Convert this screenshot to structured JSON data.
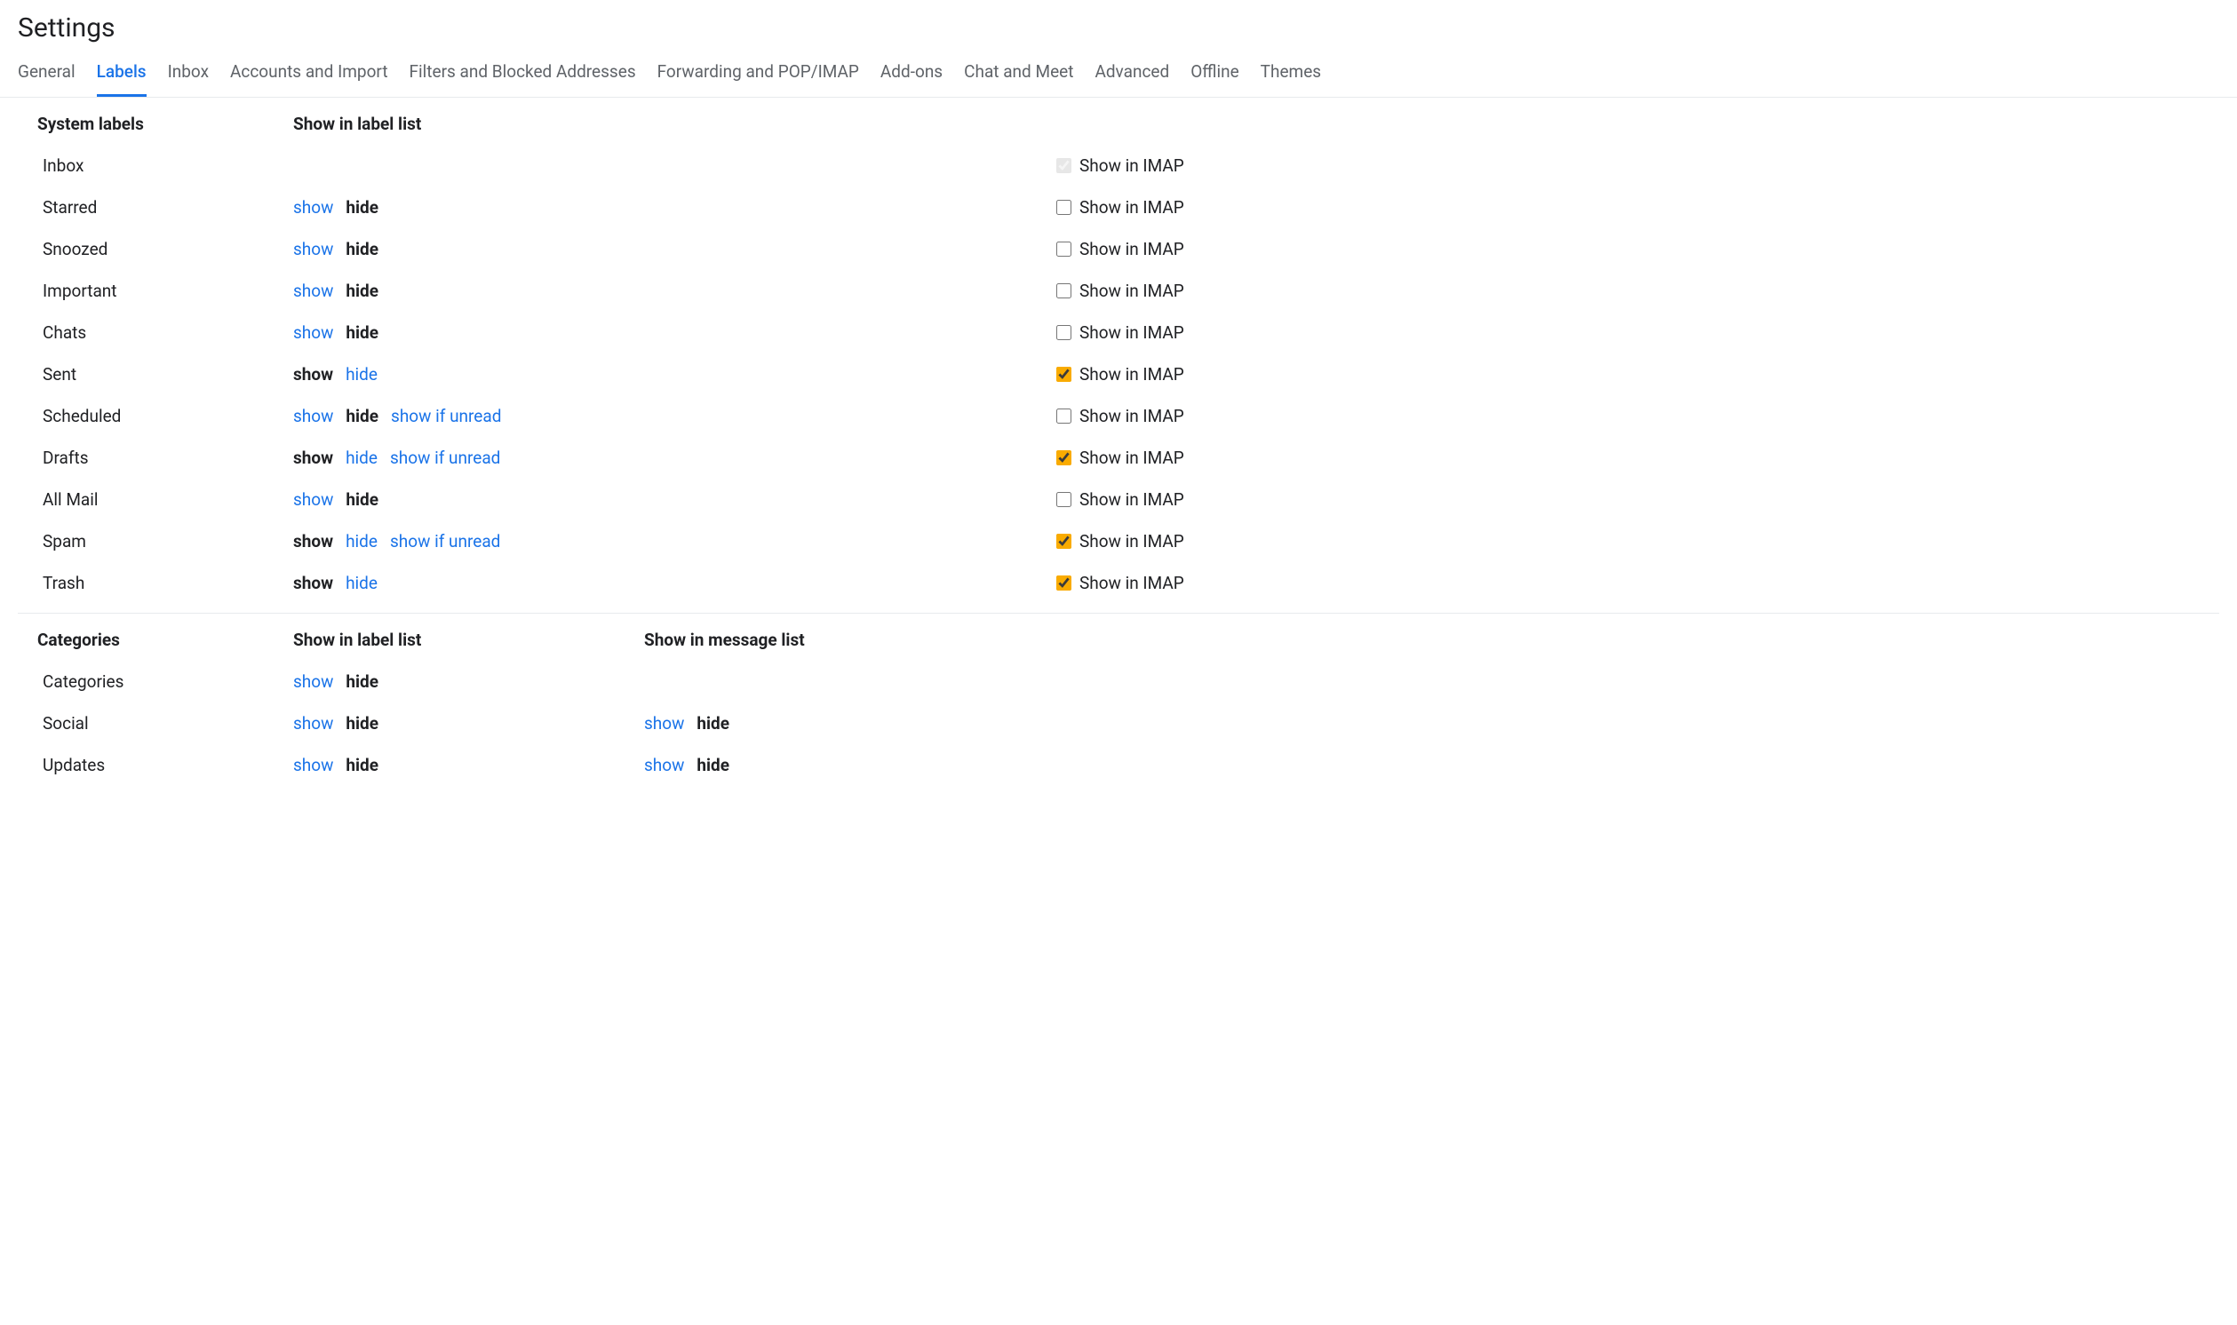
{
  "page_title": "Settings",
  "tabs": [
    {
      "id": "general",
      "label": "General",
      "active": false
    },
    {
      "id": "labels",
      "label": "Labels",
      "active": true
    },
    {
      "id": "inbox",
      "label": "Inbox",
      "active": false
    },
    {
      "id": "accounts",
      "label": "Accounts and Import",
      "active": false
    },
    {
      "id": "filters",
      "label": "Filters and Blocked Addresses",
      "active": false
    },
    {
      "id": "forwarding",
      "label": "Forwarding and POP/IMAP",
      "active": false
    },
    {
      "id": "addons",
      "label": "Add-ons",
      "active": false
    },
    {
      "id": "chat",
      "label": "Chat and Meet",
      "active": false
    },
    {
      "id": "advanced",
      "label": "Advanced",
      "active": false
    },
    {
      "id": "offline",
      "label": "Offline",
      "active": false
    },
    {
      "id": "themes",
      "label": "Themes",
      "active": false
    }
  ],
  "headers": {
    "system_labels": "System labels",
    "categories": "Categories",
    "show_in_label_list": "Show in label list",
    "show_in_message_list": "Show in message list"
  },
  "imap_label": "Show in IMAP",
  "opt_labels": {
    "show": "show",
    "hide": "hide",
    "show_if_unread": "show if unread"
  },
  "system_rows": [
    {
      "name": "Inbox",
      "opts": [],
      "imap": {
        "shown": true,
        "checked": true,
        "locked": true
      }
    },
    {
      "name": "Starred",
      "opts": [
        {
          "t": "show",
          "a": "link"
        },
        {
          "t": "hide",
          "a": "bold"
        }
      ],
      "imap": {
        "shown": true,
        "checked": false,
        "locked": false
      }
    },
    {
      "name": "Snoozed",
      "opts": [
        {
          "t": "show",
          "a": "link"
        },
        {
          "t": "hide",
          "a": "bold"
        }
      ],
      "imap": {
        "shown": true,
        "checked": false,
        "locked": false
      }
    },
    {
      "name": "Important",
      "opts": [
        {
          "t": "show",
          "a": "link"
        },
        {
          "t": "hide",
          "a": "bold"
        }
      ],
      "imap": {
        "shown": true,
        "checked": false,
        "locked": false
      }
    },
    {
      "name": "Chats",
      "opts": [
        {
          "t": "show",
          "a": "link"
        },
        {
          "t": "hide",
          "a": "bold"
        }
      ],
      "imap": {
        "shown": true,
        "checked": false,
        "locked": false
      }
    },
    {
      "name": "Sent",
      "opts": [
        {
          "t": "show",
          "a": "bold"
        },
        {
          "t": "hide",
          "a": "link"
        }
      ],
      "imap": {
        "shown": true,
        "checked": true,
        "locked": false
      }
    },
    {
      "name": "Scheduled",
      "opts": [
        {
          "t": "show",
          "a": "link"
        },
        {
          "t": "hide",
          "a": "bold"
        },
        {
          "t": "show_if_unread",
          "a": "link"
        }
      ],
      "imap": {
        "shown": true,
        "checked": false,
        "locked": false
      }
    },
    {
      "name": "Drafts",
      "opts": [
        {
          "t": "show",
          "a": "bold"
        },
        {
          "t": "hide",
          "a": "link"
        },
        {
          "t": "show_if_unread",
          "a": "link"
        }
      ],
      "imap": {
        "shown": true,
        "checked": true,
        "locked": false
      }
    },
    {
      "name": "All Mail",
      "opts": [
        {
          "t": "show",
          "a": "link"
        },
        {
          "t": "hide",
          "a": "bold"
        }
      ],
      "imap": {
        "shown": true,
        "checked": false,
        "locked": false
      }
    },
    {
      "name": "Spam",
      "opts": [
        {
          "t": "show",
          "a": "bold"
        },
        {
          "t": "hide",
          "a": "link"
        },
        {
          "t": "show_if_unread",
          "a": "link"
        }
      ],
      "imap": {
        "shown": true,
        "checked": true,
        "locked": false
      }
    },
    {
      "name": "Trash",
      "opts": [
        {
          "t": "show",
          "a": "bold"
        },
        {
          "t": "hide",
          "a": "link"
        }
      ],
      "imap": {
        "shown": true,
        "checked": true,
        "locked": false
      }
    }
  ],
  "category_rows": [
    {
      "name": "Categories",
      "label_opts": [
        {
          "t": "show",
          "a": "link"
        },
        {
          "t": "hide",
          "a": "bold"
        }
      ],
      "msg_opts": []
    },
    {
      "name": "Social",
      "label_opts": [
        {
          "t": "show",
          "a": "link"
        },
        {
          "t": "hide",
          "a": "bold"
        }
      ],
      "msg_opts": [
        {
          "t": "show",
          "a": "link"
        },
        {
          "t": "hide",
          "a": "bold"
        }
      ]
    },
    {
      "name": "Updates",
      "label_opts": [
        {
          "t": "show",
          "a": "link"
        },
        {
          "t": "hide",
          "a": "bold"
        }
      ],
      "msg_opts": [
        {
          "t": "show",
          "a": "link"
        },
        {
          "t": "hide",
          "a": "bold"
        }
      ]
    }
  ]
}
